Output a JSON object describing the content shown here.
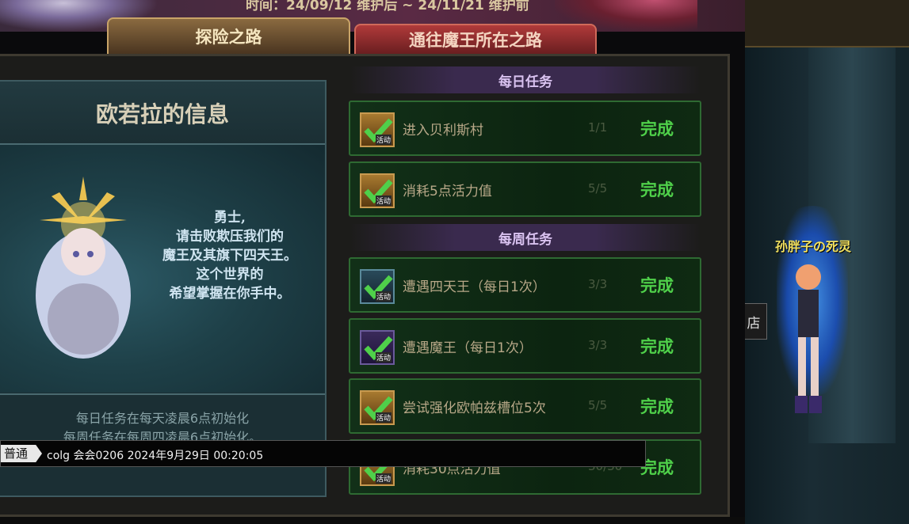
{
  "banner": {
    "text": "时间：24/09/12 维护后 ~ 24/11/21 维护前"
  },
  "tabs": [
    {
      "label": "探险之路",
      "active": true
    },
    {
      "label": "通往魔王所在之路",
      "active": false
    }
  ],
  "info": {
    "title": "欧若拉的信息",
    "speech": [
      "勇士,",
      "请击败欺压我们的",
      "魔王及其旗下四天王。",
      "这个世界的",
      "希望掌握在你手中。"
    ],
    "rules": [
      "每日任务在每天凌晨6点初始化",
      "每周任务在每周四凌晨6点初始化。"
    ]
  },
  "daily_title": "每日任务",
  "weekly_title": "每周任务",
  "quests": [
    {
      "name": "进入贝利斯村",
      "progress": "1/1",
      "status": "完成",
      "icon": "quest-scroll-icon",
      "icon_tag": "活动"
    },
    {
      "name": "消耗5点活力值",
      "progress": "5/5",
      "status": "完成",
      "icon": "quest-scroll-icon",
      "icon_tag": "活动"
    },
    {
      "name": "遭遇四天王（每日1次）",
      "progress": "3/3",
      "status": "完成",
      "icon": "quest-crest-icon",
      "icon_tag": "活动"
    },
    {
      "name": "遭遇魔王（每日1次）",
      "progress": "3/3",
      "status": "完成",
      "icon": "quest-orb-icon",
      "icon_tag": "活动"
    },
    {
      "name": "尝试强化欧帕兹槽位5次",
      "progress": "5/5",
      "status": "完成",
      "icon": "quest-scroll-icon",
      "icon_tag": "活动"
    },
    {
      "name": "消耗30点活力值",
      "progress": "30/30",
      "status": "完成",
      "icon": "quest-scroll-icon",
      "icon_tag": "活动"
    }
  ],
  "scene": {
    "player_name": "孙胖子の死灵",
    "shop_label": "店"
  },
  "chat": {
    "channel": "普通",
    "message": "colg 会会0206 2024年9月29日 00:20:05"
  },
  "colors": {
    "done_green": "#4fd04a",
    "accent_gold": "#c9a468",
    "tab_red": "#b03a3a"
  }
}
